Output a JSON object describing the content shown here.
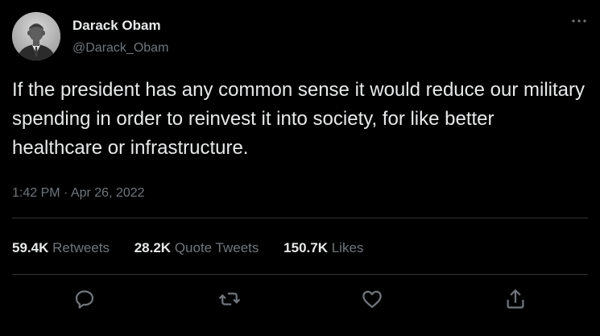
{
  "author": {
    "name": "Darack Obam",
    "handle": "@Darack_Obam"
  },
  "tweet": {
    "text": "If the president has any common sense it would reduce our military spending in order to reinvest it into society, for like better healthcare or infrastructure.",
    "time": "1:42 PM",
    "separator": "·",
    "date": "Apr 26, 2022"
  },
  "stats": {
    "retweets_count": "59.4K",
    "retweets_label": "Retweets",
    "quotes_count": "28.2K",
    "quotes_label": "Quote Tweets",
    "likes_count": "150.7K",
    "likes_label": "Likes"
  },
  "icons": {
    "more": "more-horizontal-icon",
    "reply": "reply-icon",
    "retweet": "retweet-icon",
    "like": "heart-icon",
    "share": "share-icon"
  },
  "colors": {
    "background": "#000000",
    "text_primary": "#e7e9ea",
    "text_secondary": "#71767b",
    "divider": "#2f3336"
  }
}
